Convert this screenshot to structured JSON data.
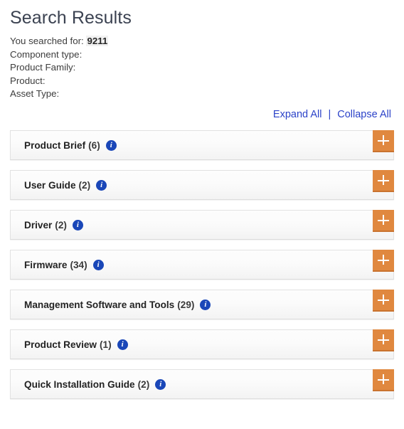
{
  "page": {
    "title": "Search Results"
  },
  "criteria": {
    "searched_for_label": "You searched for:",
    "searched_for_value": "9211",
    "lines": [
      {
        "label": "Component type:",
        "value": ""
      },
      {
        "label": "Product Family:",
        "value": ""
      },
      {
        "label": "Product:",
        "value": ""
      },
      {
        "label": "Asset Type:",
        "value": ""
      }
    ]
  },
  "controls": {
    "expand_all": "Expand All",
    "separator": "|",
    "collapse_all": "Collapse All"
  },
  "accordion": {
    "toggle_icon": "plus-icon",
    "info_icon": "info-icon",
    "rows": [
      {
        "name": "Product Brief",
        "count": "(6)"
      },
      {
        "name": "User Guide",
        "count": "(2)"
      },
      {
        "name": "Driver",
        "count": "(2)"
      },
      {
        "name": "Firmware",
        "count": "(34)"
      },
      {
        "name": "Management Software and Tools",
        "count": "(29)"
      },
      {
        "name": "Product Review",
        "count": "(1)"
      },
      {
        "name": "Quick Installation Guide",
        "count": "(2)"
      }
    ]
  },
  "colors": {
    "accent_orange": "#e0883f",
    "link_blue": "#2b42c8",
    "info_blue": "#1a47b8",
    "title_gray": "#3b4251"
  }
}
